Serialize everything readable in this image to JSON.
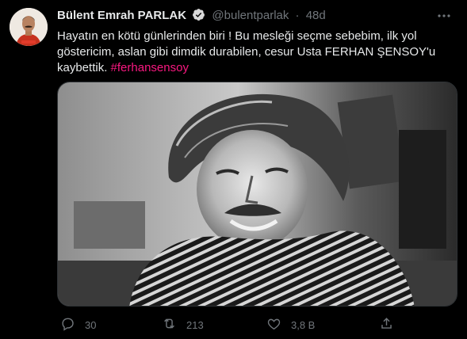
{
  "tweet": {
    "display_name": "Bülent Emrah PARLAK",
    "handle": "@bulentparlak",
    "separator": "·",
    "time": "48d",
    "text_lines": [
      "Hayatın en kötü günlerinden biri ! Bu mesleği seçme sebebim, ilk yol",
      "göstericim, aslan gibi dimdik durabilen, cesur Usta FERHAN ŞENSOY'u",
      "kaybettik."
    ],
    "hashtag": "#ferhansensoy"
  },
  "actions": {
    "reply_count": "30",
    "retweet_count": "213",
    "like_count": "3,8 B"
  },
  "colors": {
    "background": "#000000",
    "text": "#e7e9ea",
    "secondary": "#71767b",
    "hashtag": "#f91880",
    "verified": "#d9d9d9"
  },
  "icons": {
    "verified": "verified-badge-icon",
    "more": "more-options-icon",
    "reply": "reply-icon",
    "retweet": "retweet-icon",
    "like": "like-icon",
    "share": "share-icon"
  }
}
